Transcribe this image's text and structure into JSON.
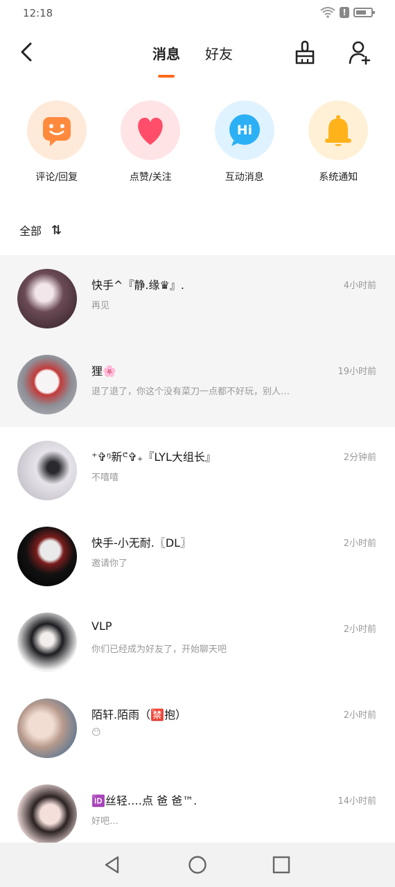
{
  "status_bar": {
    "time": "12:18",
    "alert_glyph": "!",
    "icons": [
      "wifi-icon",
      "alert-icon",
      "battery-icon"
    ]
  },
  "header": {
    "tabs": [
      {
        "label": "消息",
        "active": true
      },
      {
        "label": "好友",
        "active": false
      }
    ],
    "accent_color": "#ff6a1a",
    "actions": [
      "back-icon",
      "broom-icon",
      "add-user-icon"
    ]
  },
  "quick_actions": [
    {
      "label": "评论/回复",
      "icon": "comment-icon",
      "bg": "#ffe9d9",
      "color": "#ff8a3d"
    },
    {
      "label": "点赞/关注",
      "icon": "heart-icon",
      "bg": "#ffe4e6",
      "color": "#ff4d6a"
    },
    {
      "label": "互动消息",
      "icon": "hi-icon",
      "bg": "#dff2ff",
      "color": "#2bb0f5",
      "glyph": "Hi"
    },
    {
      "label": "系统通知",
      "icon": "bell-icon",
      "bg": "#fff0d6",
      "color": "#ffb21a"
    }
  ],
  "sort": {
    "label": "全部",
    "glyph": "⇅"
  },
  "conversations": [
    {
      "name": "快手^『静.缘♛』.",
      "preview": "再见",
      "time": "4小时前",
      "pinned": true,
      "avatar_color": "#8a6a7a"
    },
    {
      "name": "狸🌸",
      "preview": "退了退了，你这个没有菜刀一点都不好玩，别人…",
      "time": "19小时前",
      "pinned": true,
      "avatar_color": "#b0b0b8"
    },
    {
      "name": "⁺✞ᵑ新ᕪ✞₊『LYL大组长』",
      "preview": "不嘻嘻",
      "time": "2分钟前",
      "pinned": false,
      "avatar_color": "#c8c4cc"
    },
    {
      "name": "快手-小无耐.〖DL〗",
      "preview": "邀请你了",
      "time": "2小时前",
      "pinned": false,
      "avatar_color": "#1a1a1a"
    },
    {
      "name": "VLP",
      "preview": "你们已经成为好友了，开始聊天吧",
      "time": "2小时前",
      "pinned": false,
      "avatar_color": "#e8e8e8"
    },
    {
      "name": "陌轩.陌雨（🈲抱）",
      "preview": "😶",
      "time": "2小时前",
      "pinned": false,
      "avatar_color": "#c9b8b0"
    },
    {
      "name": "🆔丝轻.…点 爸 爸™.",
      "preview": "好吧…",
      "time": "14小时前",
      "pinned": false,
      "avatar_color": "#d9c8c8"
    }
  ],
  "nav_bar": {
    "buttons": [
      "back-triangle-icon",
      "home-circle-icon",
      "recents-square-icon"
    ]
  }
}
